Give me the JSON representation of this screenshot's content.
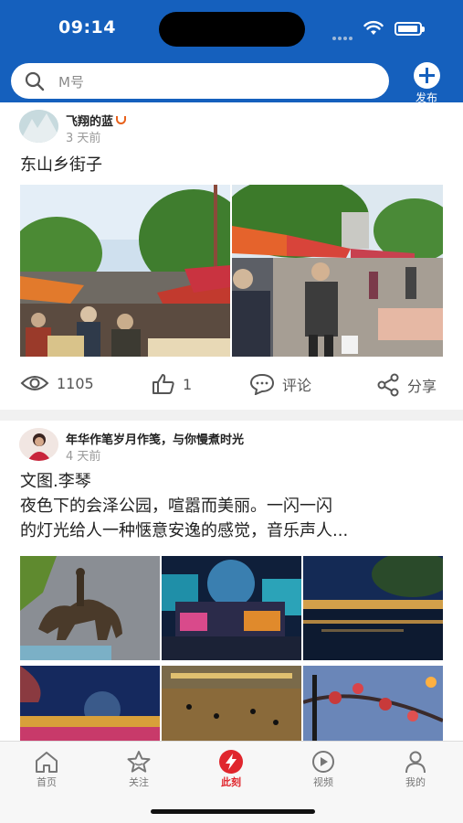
{
  "status_bar": {
    "time": "09:14"
  },
  "search": {
    "placeholder": "M号"
  },
  "header": {
    "publish_label": "发布"
  },
  "posts": [
    {
      "author": "飞翔的蓝",
      "time_ago": "3 天前",
      "title": "东山乡街子",
      "images": [
        "market-street-left",
        "market-street-right"
      ],
      "views": "1105",
      "likes": "1",
      "comment_label": "评论",
      "share_label": "分享"
    },
    {
      "author": "年华作笔岁月作笺，与你慢煮时光",
      "time_ago": "4 天前",
      "text_lines": [
        "文图.李琴",
        "夜色下的会泽公园，喧嚣而美丽。一闪一闪",
        "的灯光给人一种惬意安逸的感觉，音乐声人..."
      ],
      "images": [
        "horse-statue",
        "fountain-globe",
        "lake-night",
        "park-night-globe",
        "plaza-crowd",
        "blossom-branch"
      ]
    }
  ],
  "tabbar": {
    "items": [
      {
        "label": "首页",
        "icon": "home-icon"
      },
      {
        "label": "关注",
        "icon": "star-icon"
      },
      {
        "label": "此刻",
        "icon": "lightning-icon",
        "active": true
      },
      {
        "label": "视频",
        "icon": "play-icon"
      },
      {
        "label": "我的",
        "icon": "user-icon"
      }
    ]
  },
  "colors": {
    "brand": "#1560bd",
    "accent": "#e0262d",
    "badge": "#e8611b"
  }
}
